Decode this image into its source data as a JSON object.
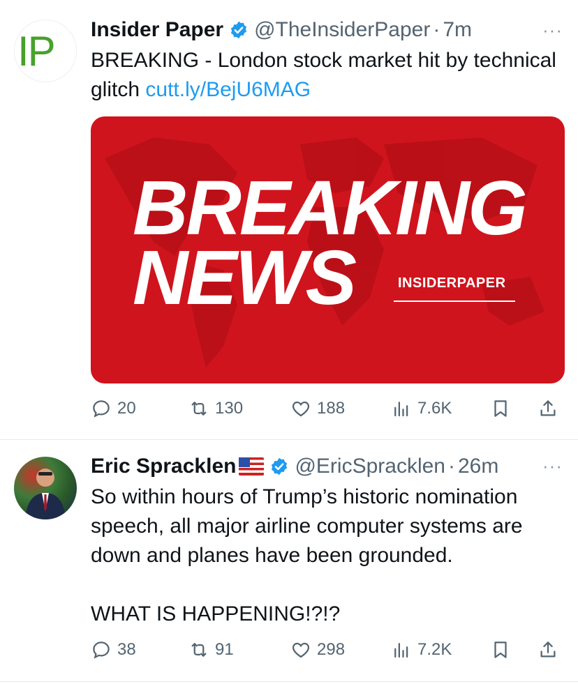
{
  "tweets": [
    {
      "author": "Insider Paper",
      "handle": "@TheInsiderPaper",
      "separator": "·",
      "time": "7m",
      "text": "BREAKING - London stock market hit by technical glitch",
      "link": "cutt.ly/BejU6MAG",
      "media": {
        "line1": "BREAKING",
        "line2": "NEWS",
        "brand": "INSIDERPAPER",
        "background_color": "#d0141d"
      },
      "avatar_text": "IP",
      "replies": "20",
      "reposts": "130",
      "likes": "188",
      "views": "7.6K",
      "more": "···"
    },
    {
      "author": "Eric Spracklen",
      "flag_icon": "us-flag-icon",
      "handle": "@EricSpracklen",
      "separator": "·",
      "time": "26m",
      "text_line1": "So within hours of Trump’s historic nomination",
      "text_line2": "speech, all major airline computer systems are",
      "text_line3": "down and planes have been grounded.",
      "text_line4": "WHAT IS HAPPENING!?!?",
      "replies": "38",
      "reposts": "91",
      "likes": "298",
      "views": "7.2K",
      "more": "···"
    }
  ],
  "colors": {
    "verified": "#1d9bf0",
    "link": "#1d9bf0",
    "muted": "#536471"
  }
}
